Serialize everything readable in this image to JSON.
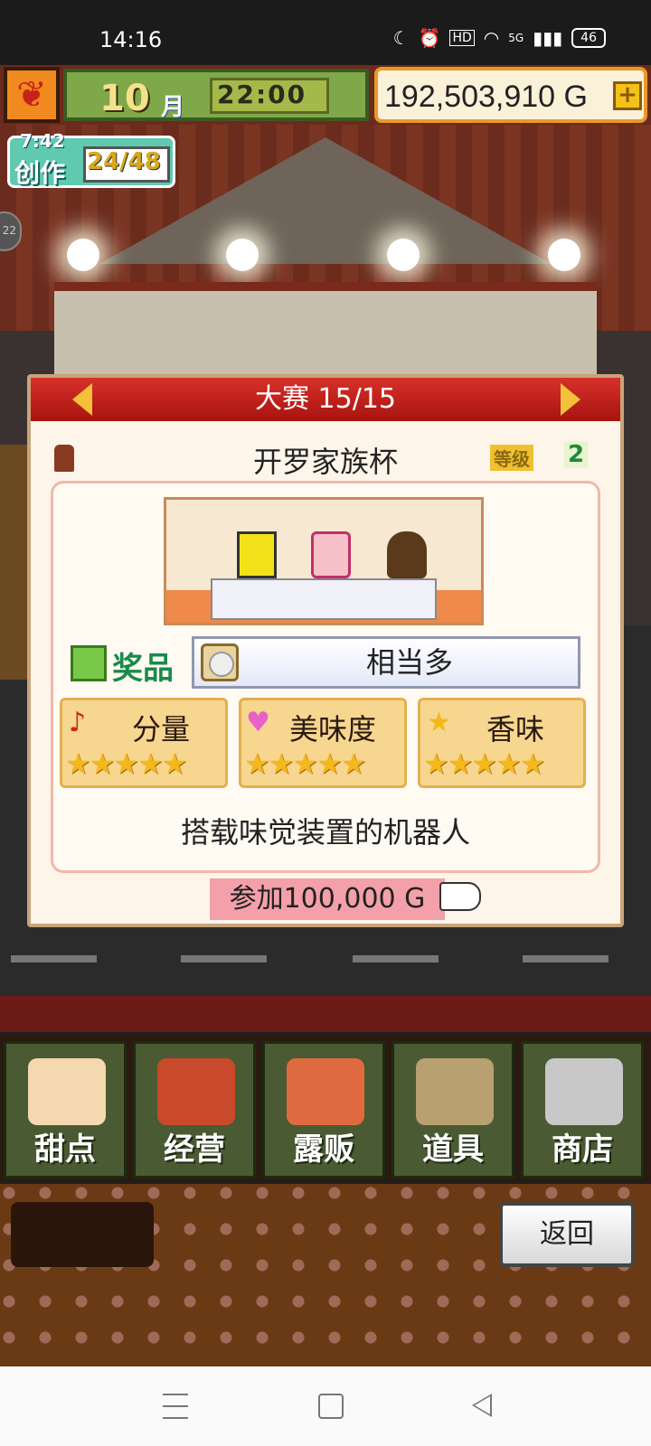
{
  "status_bar": {
    "time": "14:16",
    "hd": "HD",
    "signal": "5G",
    "battery": "46"
  },
  "hud": {
    "month_number": "10",
    "month_label": "月",
    "clock": "22:00",
    "money": "192,503,910 G",
    "plus": "+"
  },
  "craft": {
    "timer": "7:42",
    "label": "创作",
    "count": "24/48"
  },
  "side_pill": "22",
  "contest": {
    "header": "大赛 15/15",
    "name": "开罗家族杯",
    "rank_tag": "等级",
    "rank_value": "2",
    "prize_label": "奖品",
    "prize_value": "相当多",
    "stats": [
      {
        "label": "分量",
        "icon": "♪",
        "icon_color": "#d0201a",
        "stars": "★★★★★"
      },
      {
        "label": "美味度",
        "icon": "♥",
        "icon_color": "#e860c8",
        "stars": "★★★★★"
      },
      {
        "label": "香味",
        "icon": "★",
        "icon_color": "#f2b818",
        "stars": "★★★★★"
      }
    ],
    "description": "搭载味觉装置的机器人",
    "entry_button": "参加100,000 G"
  },
  "menu": [
    {
      "label": "甜点",
      "art": "cake-icon",
      "color": "#f4d8b0"
    },
    {
      "label": "经营",
      "art": "shop-icon",
      "color": "#c84a2a"
    },
    {
      "label": "露贩",
      "art": "food-truck-icon",
      "color": "#e06a40"
    },
    {
      "label": "道具",
      "art": "tools-icon",
      "color": "#b8a070"
    },
    {
      "label": "商店",
      "art": "cart-icon",
      "color": "#c8c8c8"
    }
  ],
  "back_button": "返回",
  "colors": {
    "header_red": "#c01e18",
    "prize_green": "#1a8a4a",
    "star_gold": "#f5b81a",
    "entry_pink": "#f4a0aa"
  }
}
